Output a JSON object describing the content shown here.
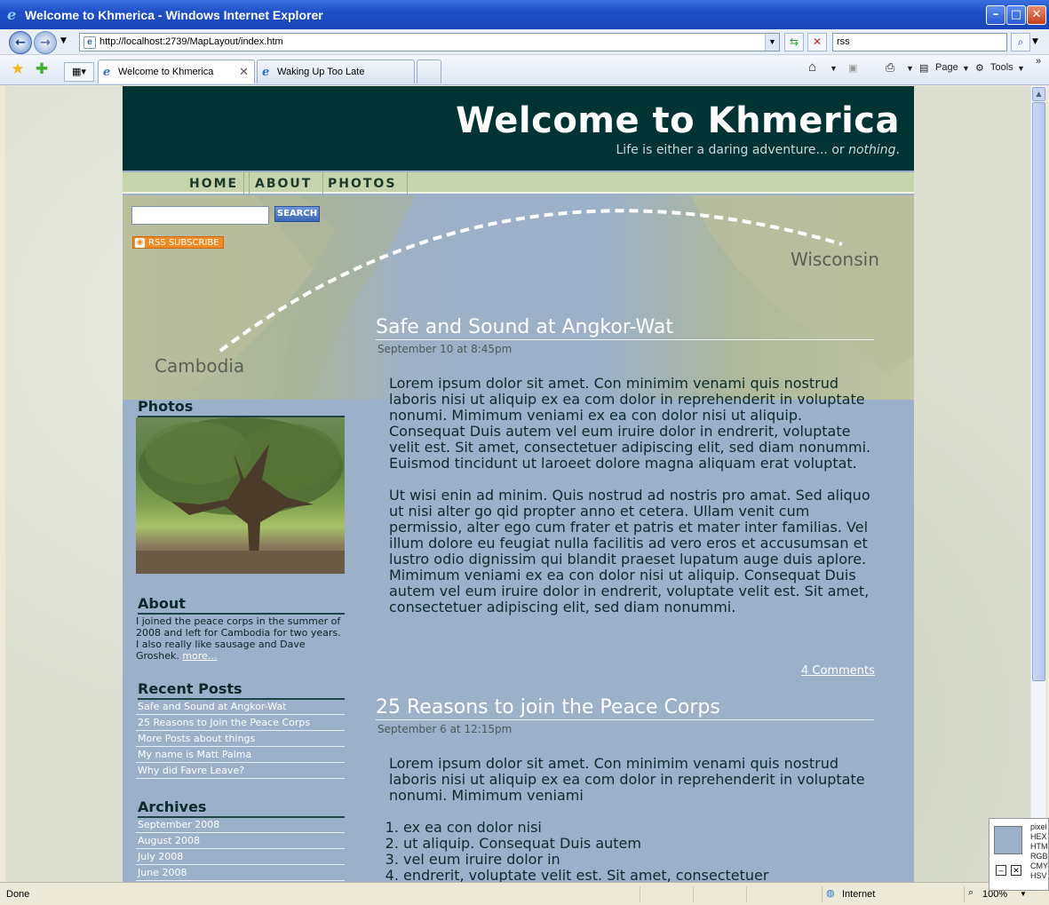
{
  "window": {
    "title": "Welcome to Khmerica - Windows Internet Explorer",
    "address": "http://localhost:2739/MapLayout/index.htm",
    "search_value": "rss"
  },
  "tabs": [
    {
      "label": "Welcome to Khmerica",
      "active": true
    },
    {
      "label": "Waking Up Too Late",
      "active": false
    }
  ],
  "toolbar": {
    "page_label": "Page",
    "tools_label": "Tools"
  },
  "site": {
    "title": "Welcome to Khmerica",
    "tagline_prefix": "Life is either a daring adventure... or ",
    "tagline_emph": "nothing",
    "tagline_suffix": ".",
    "nav": [
      "HOME",
      "ABOUT",
      "PHOTOS"
    ],
    "search_button": "SEARCH",
    "rss_label": "RSS SUBSCRIBE",
    "map_labels": {
      "origin": "Cambodia",
      "destination": "Wisconsin"
    }
  },
  "sidebar": {
    "photos_heading": "Photos",
    "about_heading": "About",
    "about_text": "I joined the peace corps in the summer of 2008 and left for Cambodia for two years. I also really like sausage and Dave Groshek.",
    "about_more": "more...",
    "recent_heading": "Recent Posts",
    "recent_posts": [
      "Safe and Sound at Angkor-Wat",
      "25 Reasons to Join the Peace Corps",
      "More Posts about things",
      "My name is Matt Palma",
      "Why did Favre Leave?"
    ],
    "archives_heading": "Archives",
    "archives": [
      "September 2008",
      "August 2008",
      "July 2008",
      "June 2008"
    ]
  },
  "posts": [
    {
      "title": "Safe and Sound at Angkor-Wat",
      "date": "September 10 at 8:45pm",
      "paragraphs": [
        "Lorem ipsum dolor sit amet. Con minimim venami quis nostrud laboris nisi ut aliquip ex ea com dolor in reprehenderit in voluptate nonumi. Mimimum veniami ex ea con dolor nisi ut aliquip. Consequat Duis autem vel eum iruire dolor in endrerit, voluptate velit est. Sit amet, consectetuer adipiscing elit, sed diam nonummi. Euismod tincidunt ut laroeet dolore magna aliquam erat voluptat.",
        "Ut wisi enin ad minim. Quis nostrud ad nostris pro amat. Sed aliquo ut nisi alter go qid propter anno et cetera. Ullam venit cum permissio, alter ego cum frater et patris et mater inter familias. Vel illum dolore eu feugiat nulla facilitis ad vero eros et accusumsan et lustro odio dignissim qui blandit praeset lupatum auge duis aplore. Mimimum veniami ex ea con dolor nisi ut aliquip. Consequat Duis autem vel eum iruire dolor in endrerit, voluptate velit est. Sit amet, consectetuer adipiscing elit, sed diam nonummi."
      ],
      "comments": "4 Comments"
    },
    {
      "title": "25 Reasons to join the Peace Corps",
      "date": "September 6 at 12:15pm",
      "paragraphs": [
        "Lorem ipsum dolor sit amet. Con minimim venami quis nostrud laboris nisi ut aliquip ex ea com dolor in reprehenderit in voluptate nonumi. Mimimum veniami"
      ],
      "list": [
        "ex ea con dolor nisi",
        "ut aliquip. Consequat Duis autem",
        "vel eum iruire dolor in",
        "endrerit, voluptate velit est. Sit amet, consectetuer"
      ]
    }
  ],
  "statusbar": {
    "left": "Done",
    "zone": "Internet",
    "zoom": "100%"
  },
  "colorpicker": {
    "labels": [
      "pixel",
      "HEX",
      "HTM",
      "RGB",
      "CMY",
      "HSV"
    ],
    "swatch": "#9cb0c9"
  }
}
